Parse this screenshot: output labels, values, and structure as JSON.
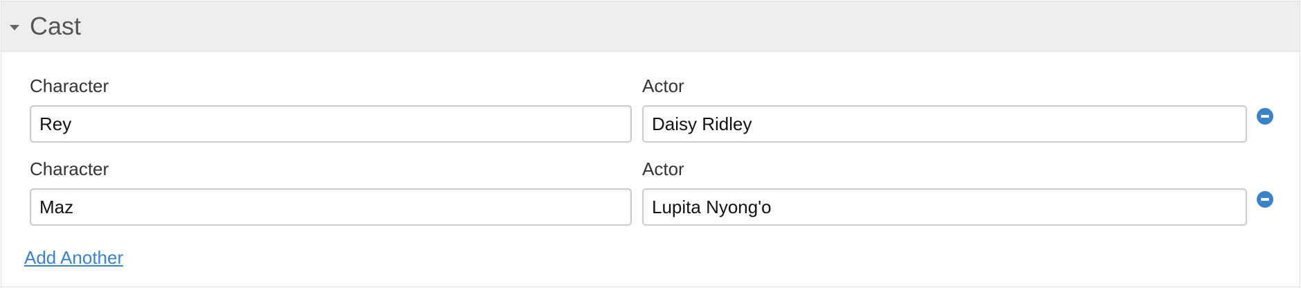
{
  "panel": {
    "title": "Cast",
    "expanded": true,
    "toggle_icon": "caret-down-icon"
  },
  "rows": [
    {
      "character_label": "Character",
      "character_value": "Rey",
      "actor_label": "Actor",
      "actor_value": "Daisy Ridley",
      "remove_icon": "minus-circle-icon"
    },
    {
      "character_label": "Character",
      "character_value": "Maz",
      "actor_label": "Actor",
      "actor_value": "Lupita Nyong'o",
      "remove_icon": "minus-circle-icon"
    }
  ],
  "add_link_label": "Add Another",
  "colors": {
    "accent": "#3a83c9",
    "header_bg": "#eeeeee",
    "border": "#cccccc"
  }
}
